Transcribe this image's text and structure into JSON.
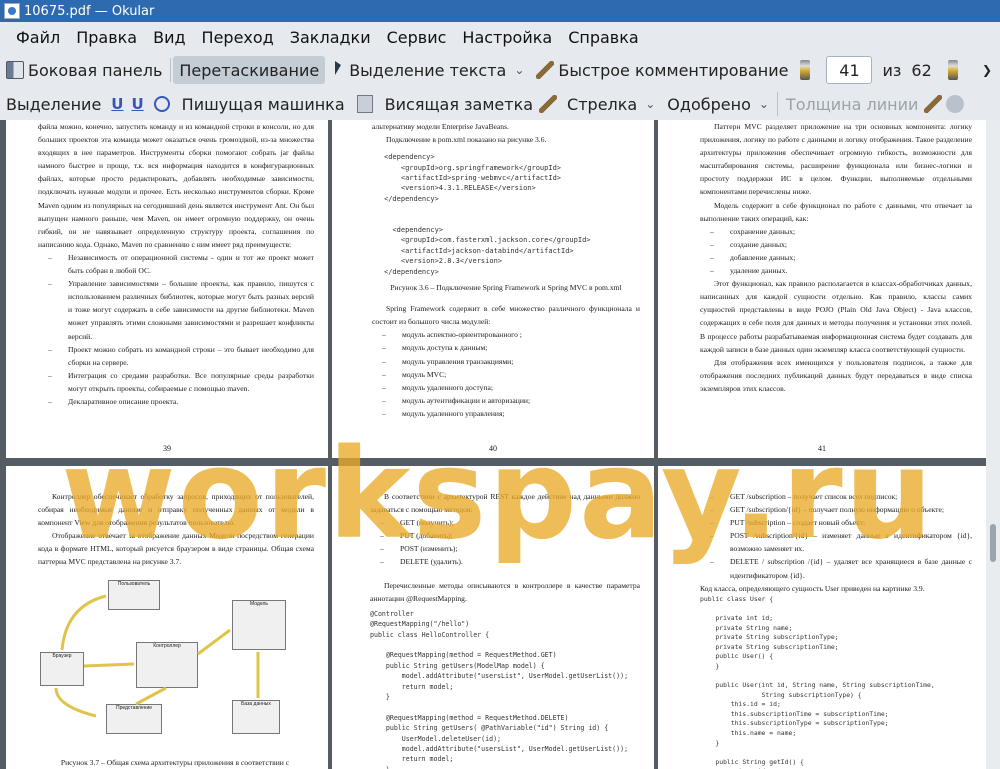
{
  "window": {
    "title": "10675.pdf — Okular"
  },
  "menu": [
    "Файл",
    "Правка",
    "Вид",
    "Переход",
    "Закладки",
    "Сервис",
    "Настройка",
    "Справка"
  ],
  "toolbar1": {
    "sidebar": "Боковая панель",
    "drag": "Перетаскивание",
    "text_select": "Выделение текста",
    "quick_comment": "Быстрое комментирование",
    "page_current": "41",
    "page_of": "из",
    "page_total": "62"
  },
  "toolbar2": {
    "highlight": "Выделение",
    "typewriter": "Пишущая машинка",
    "pinned_note": "Висящая заметка",
    "arrow": "Стрелка",
    "approved": "Одобрено",
    "line_width": "Толщина линии"
  },
  "pages": {
    "p39": {
      "number": "39",
      "paras": [
        "файла можно, конечно, запустить команду и из командной строки в консоли, но для больших проектов эта команда может оказаться очень громоздкой, из-за множества входящих в нее параметров. Инструменты сборки помогают собрать jar файлы намного быстрее и проще, т.к. вся информация находится в конфигурационных файлах, которые просто редактировать, добавлять необходимые зависимости, подключать нужные модули и прочее. Есть несколько инструментов сборки. Кроме Maven одним из популярных на сегодняшний день является инструмент Ant. Он был выпущен намного раньше, чем Maven, он имеет огромную поддержку, он очень гибкий, он не навязывает определенную структуру проекта, соглашения по написанию кода. Однако, Maven по сравнению с ним имеет ряд преимуществ:"
      ],
      "items": [
        "Независимость от операционной системы - один и тот же проект может быть собран в любой ОС.",
        "Управление зависимостями – большие проекты, как правило, пишутся с использованием различных библиотек, которые могут быть разных версий и тоже могут содержать в себе зависимости на другие библиотеки. Maven может управлять этими сложными зависимостями и разрешает конфликты версий.",
        "Проект можно собрать из командной строки – это бывает необходимо для сборки на сервере.",
        "Интеграция со средами разработки. Все популярные среды разработки могут открыть проекты, собираемые с помощью maven.",
        "Декларативное описание проекта."
      ]
    },
    "p40": {
      "number": "40",
      "intro": "альтернативу модели Enterprise JavaBeans.",
      "intro2": "Подключение в pom.xml показано на рисунке 3.6.",
      "code": "<dependency>\n    <groupId>org.springframework</groupId>\n    <artifactId>spring-webmvc</artifactId>\n    <version>4.3.1.RELEASE</version>\n</dependency>\n\n\n  <dependency>\n    <groupId>com.fasterxml.jackson.core</groupId>\n    <artifactId>jackson-databind</artifactId>\n    <version>2.8.3</version>\n</dependency>",
      "caption": "Рисунок 3.6 – Подключение Spring Framework и Spring MVC в pom.xml",
      "para": "Spring Framework содержит в себе множество различного функционала и состоит из большого числа модулей:",
      "items": [
        "модуль аспектно-ориентированного ;",
        "модуль доступа к данным;",
        "модуль управления транзакциями;",
        "модуль MVC;",
        "модуль удаленного доступа;",
        "модуль аутентификации и авторизации;",
        "модуль удаленного управления;"
      ]
    },
    "p41": {
      "number": "41",
      "para1": "Паттерн MVC разделяет приложение на три основных компонента: логику приложения, логику по работе с данными и логику отображения. Такое разделение архитектуры приложения обеспечивает огромную гибкость, возможности для масштабирования системы, расширение функционала или бизнес-логики и простоту поддержки ИС в целом. Функции, выполняемые отдельными компонентами перечислены ниже.",
      "para2": "Модель содержит в себе функционал по работе с данными, что отвечает за выполнение таких операций, как:",
      "items": [
        "сохранение данных;",
        "создание данных;",
        "добавление данных;",
        "удаление данных."
      ],
      "para3": "Этот функционал, как правило располагается в классах-обработчиках данных, написанных для каждой сущности отдельно. Как правило, классы самих сущностей представлены в виде POJO (Plain Old Java Object) - Java классов, содержащих в себе поля для данных и методы получения и установки этих полей. В процессе работы разрабатываемая информационная система будет создавать для каждой записи в базе данных один экземпляр класса соответствующей сущности.",
      "para4": "Для отображения всех имеющихся у пользователя подписок, а также для отображения последних публикаций данных будут передаваться в виде списка экземпляров этих классов."
    },
    "p42": {
      "para1": "Контроллер обеспечивает обработку запросов, приходящих от пользователей, собирая необходимые данные и отправку полученных данных от модели в компонент View для отображения результатов пользователю.",
      "para2": "Отображение отвечает за отображение данных Модели посредством генерации кода в формате HTML, который рисуется браузером в виде страницы. Общая схема паттерна MVC представлена на рисунке 3.7.",
      "caption": "Рисунок 3.7 – Общая схема архитектуры приложения в соответствии с",
      "diagram": {
        "user": "Пользователь",
        "browser": "Браузер",
        "controller": "Контроллер",
        "model": "Модель",
        "view": "Представление",
        "db": "База данных"
      }
    },
    "p43": {
      "para1": "В соответствии с архитектурой REST каждое действие над данными должно задаваться с помощью методов:",
      "items": [
        "GET (получить);",
        "PUT (добавить);",
        "POST (изменить);",
        "DELETE (удалить)."
      ],
      "para2": "Перечисленные методы описываются в контроллере в качестве параметра аннотации @RequestMapping.",
      "code": "@Controller\n@RequestMapping(\"/hello\")\npublic class HelloController {\n\n    @RequestMapping(method = RequestMethod.GET)\n    public String getUsers(ModelMap model) {\n        model.addAttribute(\"usersList\", UserModel.getUserList());\n        return model;\n    }\n\n    @RequestMapping(method = RequestMethod.DELETE)\n    public String getUsers( @PathVariable(\"id\") String id) {\n        UserModel.deleteUser(id);\n        model.addAttribute(\"usersList\", UserModel.getUserList());\n        return model;\n    }\n}"
    },
    "p44": {
      "items": [
        "GET /subscription – получает список всех подписок;",
        "GET /subscription/{id} – получает полную информацию о объекте;",
        "PUT /subscription – создает новый объект;",
        "POST /subscription/{id} – изменяет данные с идентификатором {id}, возможно заменяет их.",
        "DELETE / subscription /{id} – удаляет все хранящиеся в базе данные с идентификатором {id}."
      ],
      "para": "Код класса, определяющего сущность User приведен на картинке 3.9.",
      "code": "public class User {\n\n    private int id;\n    private String name;\n    private String subscriptionType;\n    private String subscriptionTime;\n    public User() {\n    }\n\n    public User(int id, String name, String subscriptionTime,\n                String subscriptionType) {\n        this.id = id;\n        this.subscriptionTime = subscriptionTime;\n        this.subscriptionType = subscriptionType;\n        this.name = name;\n    }\n\n    public String getId() {\n        return id;\n    }"
    }
  },
  "watermark": "workspay.ru"
}
